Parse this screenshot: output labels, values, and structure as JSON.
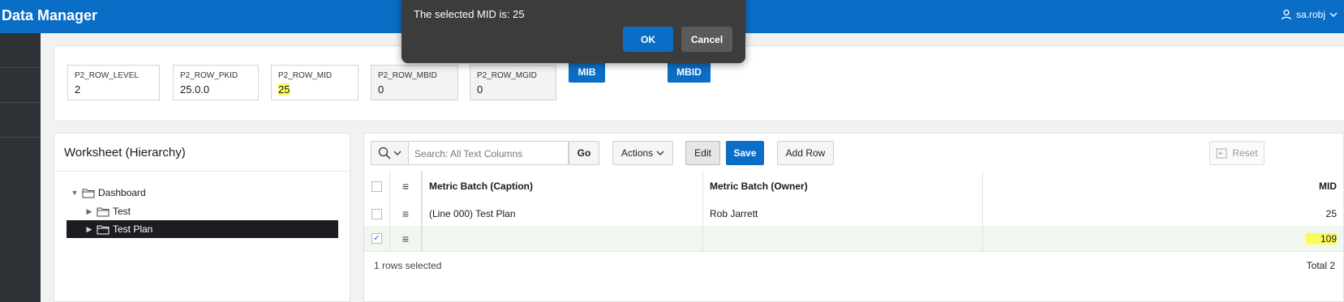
{
  "header": {
    "app_title": "Data Manager",
    "user_name": "sa.robj"
  },
  "page_items": {
    "row_level": {
      "label": "P2_ROW_LEVEL",
      "value": "2"
    },
    "row_pkid": {
      "label": "P2_ROW_PKID",
      "value": "25.0.0"
    },
    "row_mid": {
      "label": "P2_ROW_MID",
      "value": "25"
    },
    "row_mbid": {
      "label": "P2_ROW_MBID",
      "value": "0"
    },
    "row_mgid": {
      "label": "P2_ROW_MGID",
      "value": "0"
    },
    "mib_button": "MIB",
    "mbid_button": "MBID"
  },
  "tree": {
    "title": "Worksheet (Hierarchy)",
    "nodes": [
      {
        "label": "Dashboard",
        "expanded": true,
        "selected": false
      },
      {
        "label": "Test",
        "expanded": false,
        "selected": false
      },
      {
        "label": "Test Plan",
        "expanded": false,
        "selected": true
      }
    ]
  },
  "grid": {
    "toolbar": {
      "search_placeholder": "Search: All Text Columns",
      "go": "Go",
      "actions": "Actions",
      "edit": "Edit",
      "save": "Save",
      "add_row": "Add Row",
      "reset": "Reset"
    },
    "columns": [
      "Metric Batch (Caption)",
      "Metric Batch (Owner)",
      "MID"
    ],
    "rows": [
      {
        "caption": "(Line 000) Test Plan",
        "owner": "Rob Jarrett",
        "mid": "25",
        "selected": false
      },
      {
        "caption": "",
        "owner": "",
        "mid": "109",
        "selected": true
      }
    ],
    "footer": {
      "selection": "1 rows selected",
      "total": "Total 2"
    }
  },
  "dialog": {
    "message": "The selected MID is: 25",
    "ok": "OK",
    "cancel": "Cancel"
  },
  "colors": {
    "header": "#0a6ec7",
    "nav": "#2f3338",
    "highlight": "#fbfb5e",
    "selected_row": "#f1f7ee"
  }
}
